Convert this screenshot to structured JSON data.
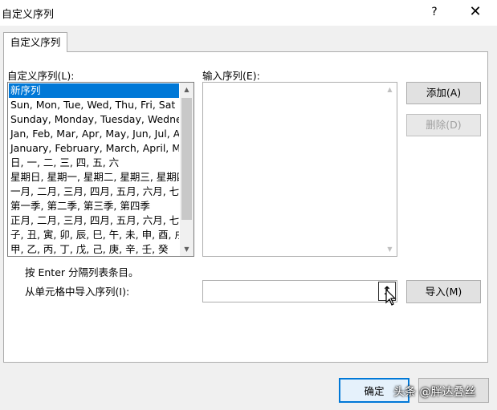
{
  "window": {
    "title": "自定义序列",
    "help": "?",
    "close": "✕"
  },
  "tab": {
    "label": "自定义序列"
  },
  "custom_list": {
    "label": "自定义序列(L):",
    "items": [
      "新序列",
      "Sun, Mon, Tue, Wed, Thu, Fri, Sat",
      "Sunday, Monday, Tuesday, Wednesday",
      "Jan, Feb, Mar, Apr, May, Jun, Jul, Aug",
      "January, February, March, April, May",
      "日, 一, 二, 三, 四, 五, 六",
      "星期日, 星期一, 星期二, 星期三, 星期四",
      "一月, 二月, 三月, 四月, 五月, 六月, 七月",
      "第一季, 第二季, 第三季, 第四季",
      "正月, 二月, 三月, 四月, 五月, 六月, 七月",
      "子, 丑, 寅, 卯, 辰, 巳, 午, 未, 申, 酉, 戌",
      "甲, 乙, 丙, 丁, 戊, 己, 庚, 辛, 壬, 癸"
    ],
    "selected_index": 0
  },
  "input_list": {
    "label": "输入序列(E):",
    "value": ""
  },
  "buttons": {
    "add": "添加(A)",
    "delete": "删除(D)",
    "import": "导入(M)",
    "ok": "确定"
  },
  "hint": "按 Enter 分隔列表条目。",
  "import_range": {
    "label": "从单元格中导入序列(I):",
    "value": "",
    "collapse_icon": "↥"
  },
  "watermark": "头条 @胖达叠丝",
  "colors": {
    "selection": "#0078d7",
    "background": "#f0f0f0",
    "panel": "#ffffff"
  }
}
